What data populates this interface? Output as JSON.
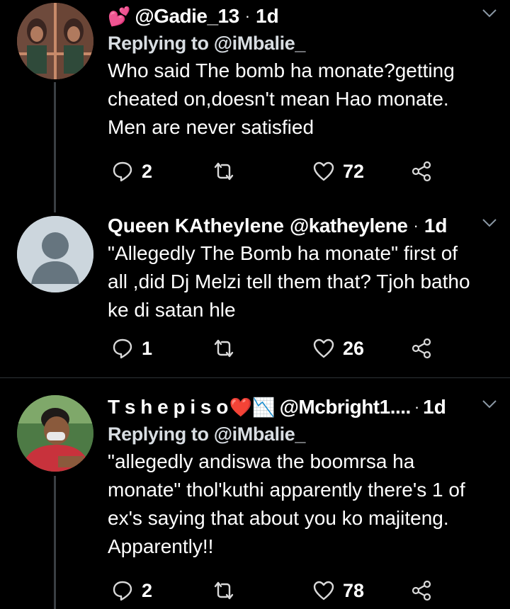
{
  "tweets": [
    {
      "emoji": "💕",
      "name": "",
      "handle": "@Gadie_13",
      "dot": "·",
      "time": "1d",
      "reply_prefix": "Replying to",
      "reply_to": "@iMbalie_",
      "text_lines": [
        "Who said The bomb ha monate?getting",
        "cheated on,doesn't mean Hao monate.",
        "Men are never satisfied"
      ],
      "replies": "2",
      "likes": "72"
    },
    {
      "emoji": "",
      "name": "Queen KAtheylene",
      "handle": "@katheylene",
      "dot": "·",
      "time": "1d",
      "reply_prefix": "",
      "reply_to": "",
      "text_lines": [
        "\"Allegedly The Bomb ha monate\"  first of",
        "all ,did Dj Melzi tell them that? Tjoh batho",
        "ke di satan hle"
      ],
      "replies": "1",
      "likes": "26"
    },
    {
      "emoji": "❤️📉",
      "name": "T s h e p i s o",
      "handle": "@Mcbright1....",
      "dot": "·",
      "time": "1d",
      "reply_prefix": "Replying to",
      "reply_to": "@iMbalie_",
      "text_lines": [
        "\"allegedly andiswa the boomrsa ha",
        "monate\" thol'kuthi apparently there's 1 of",
        "ex's saying that about you ko majiteng.",
        "Apparently!!"
      ],
      "replies": "2",
      "likes": "78"
    }
  ],
  "colors": {
    "background": "#000000",
    "text": "#ffffff",
    "divider": "#2f3336",
    "icon": "#d9d9d9"
  }
}
